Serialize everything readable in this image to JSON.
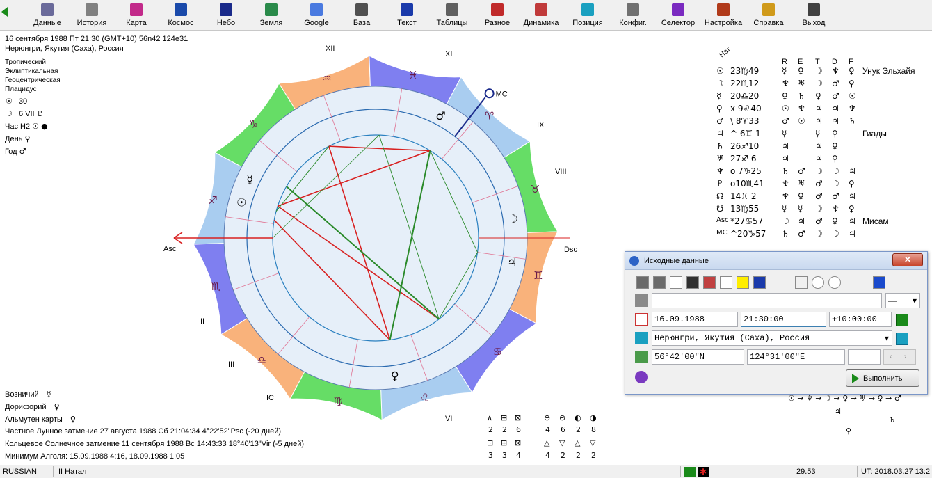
{
  "toolbar": {
    "items": [
      {
        "label": "Данные",
        "icon": "data-icon",
        "color": "#6a6a9a"
      },
      {
        "label": "История",
        "icon": "history-icon",
        "color": "#808080"
      },
      {
        "label": "Карта",
        "icon": "chart-icon",
        "color": "#c22a8a"
      },
      {
        "label": "Космос",
        "icon": "cosmos-icon",
        "color": "#1a4aaa"
      },
      {
        "label": "Небо",
        "icon": "sky-icon",
        "color": "#1a2a8a"
      },
      {
        "label": "Земля",
        "icon": "earth-icon",
        "color": "#2a8a4a"
      },
      {
        "label": "Google",
        "icon": "google-icon",
        "color": "#4a7ae0"
      },
      {
        "label": "База",
        "icon": "database-icon",
        "color": "#505050"
      },
      {
        "label": "Текст",
        "icon": "text-icon",
        "color": "#1a3aaa"
      },
      {
        "label": "Таблицы",
        "icon": "tables-icon",
        "color": "#606060"
      },
      {
        "label": "Разное",
        "icon": "misc-icon",
        "color": "#c02a2a"
      },
      {
        "label": "Динамика",
        "icon": "dynamics-icon",
        "color": "#c03a3a"
      },
      {
        "label": "Позиция",
        "icon": "position-icon",
        "color": "#1aa0c0"
      },
      {
        "label": "Конфиг.",
        "icon": "config-icon",
        "color": "#707070"
      },
      {
        "label": "Селектор",
        "icon": "selector-icon",
        "color": "#7a2ac0"
      },
      {
        "label": "Настройка",
        "icon": "settings-icon",
        "color": "#b03a1a"
      },
      {
        "label": "Справка",
        "icon": "help-icon",
        "color": "#d09a1a"
      },
      {
        "label": "Выход",
        "icon": "exit-icon",
        "color": "#404040"
      }
    ]
  },
  "header": {
    "line1": "16 сентября 1988  Пт  21:30 (GMT+10) 56n42  124e31",
    "line2": "Нерюнгри, Якутия (Саха), Россия",
    "settings": [
      "Тропический",
      "Эклиптикальная",
      "Геоцентрическая",
      "Плацидус"
    ],
    "moon_day": "30",
    "moon_phase": "6 VII",
    "hour_label": "Час H2",
    "day_label": "День",
    "year_label": "Год"
  },
  "bottom_left": {
    "lines": [
      "Возничий",
      "Дорифорий",
      "Альмутен карты",
      "Частное Лунное затмение 27 августа 1988 Сб 21:04:34  4°22'52\"Psc (-20 дней)",
      "Кольцевое Солнечное затмение 11 сентября 1988 Вс 14:43:33 18°40'13\"Vir (-5 дней)",
      "Минимум Алголя: 15.09.1988  4:16,  18.09.1988  1:05"
    ]
  },
  "wheel": {
    "houses": [
      "XII",
      "XI",
      "IX",
      "VIII",
      "II",
      "III",
      "IC",
      "VI"
    ],
    "asc": "Asc",
    "dsc": "Dsc",
    "mc": "MC",
    "sign_colors": {
      "fire": "#f9b27b",
      "earth": "#66dd66",
      "air": "#a9cdf0",
      "water": "#7f7ff0"
    },
    "planets": [
      {
        "sym": "☉",
        "angle": 15
      },
      {
        "sym": "☽",
        "angle": 172
      },
      {
        "sym": "☿",
        "angle": 25
      },
      {
        "sym": "♀",
        "angle": 262
      },
      {
        "sym": "♂",
        "angle": 118
      },
      {
        "sym": "♃",
        "angle": 190
      }
    ],
    "zodiac": [
      {
        "sym": "♓",
        "angle": 103
      },
      {
        "sym": "♈",
        "angle": 133
      },
      {
        "sym": "♉",
        "angle": 163
      },
      {
        "sym": "♊",
        "angle": 193
      },
      {
        "sym": "♋",
        "angle": 223
      },
      {
        "sym": "♌",
        "angle": 253
      },
      {
        "sym": "♍",
        "angle": 283
      },
      {
        "sym": "♎",
        "angle": 313
      },
      {
        "sym": "♏",
        "angle": 343
      },
      {
        "sym": "♐",
        "angle": 13
      },
      {
        "sym": "♑",
        "angle": 43
      },
      {
        "sym": "♒",
        "angle": 73
      }
    ]
  },
  "right_table": {
    "header_rotated": "Нат",
    "cols": [
      "R",
      "E",
      "T",
      "D",
      "F"
    ],
    "rows": [
      {
        "p": "☉",
        "deg": "23♍49",
        "c": [
          "☿",
          "♀",
          "☽",
          "♆",
          "♀"
        ],
        "note": "Унук Эльхайя"
      },
      {
        "p": "☽",
        "deg": "22♏12",
        "c": [
          "♆",
          "♅",
          "☽",
          "♂",
          "♀"
        ],
        "note": ""
      },
      {
        "p": "☿",
        "deg": "20♎20",
        "c": [
          "♀",
          "♄",
          "♀",
          "♂",
          "☉"
        ],
        "note": ""
      },
      {
        "p": "♀",
        "deg": "x 9♌40",
        "c": [
          "☉",
          "♆",
          "♃",
          "♃",
          "♆"
        ],
        "note": ""
      },
      {
        "p": "♂",
        "deg": "\\ 8♈33",
        "c": [
          "♂",
          "☉",
          "♃",
          "♃",
          "♄"
        ],
        "note": ""
      },
      {
        "p": "♃",
        "deg": "^ 6♊ 1",
        "c": [
          "☿",
          "",
          "☿",
          "♀",
          ""
        ],
        "note": "Гиады"
      },
      {
        "p": "♄",
        "deg": "26♐10",
        "c": [
          "♃",
          "",
          "♃",
          "♀",
          ""
        ],
        "note": ""
      },
      {
        "p": "♅",
        "deg": "27♐ 6",
        "c": [
          "♃",
          "",
          "♃",
          "♀",
          ""
        ],
        "note": ""
      },
      {
        "p": "♆",
        "deg": "o 7♑25",
        "c": [
          "♄",
          "♂",
          "☽",
          "☽",
          "♃"
        ],
        "note": ""
      },
      {
        "p": "♇",
        "deg": "o10♏41",
        "c": [
          "♆",
          "♅",
          "♂",
          "☽",
          "♀"
        ],
        "note": ""
      },
      {
        "p": "☊",
        "deg": "14♓ 2",
        "c": [
          "♆",
          "♀",
          "♂",
          "♂",
          "♃"
        ],
        "note": ""
      },
      {
        "p": "☋",
        "deg": "13♍55",
        "c": [
          "☿",
          "☿",
          "☽",
          "♆",
          "♀"
        ],
        "note": ""
      },
      {
        "p": "Asc",
        "deg": "*27♋57",
        "c": [
          "☽",
          "♃",
          "♂",
          "♀",
          "♃"
        ],
        "note": "Мисам"
      },
      {
        "p": "MC",
        "deg": "^20♑57",
        "c": [
          "♄",
          "♂",
          "☽",
          "☽",
          "♃"
        ],
        "note": ""
      }
    ]
  },
  "dialog": {
    "title": "Исходные данные",
    "name_value": "",
    "name_dropdown": "—",
    "date_value": "16.09.1988",
    "time_value": "21:30:00",
    "tz_value": "+10:00:00",
    "place_value": "Нерюнгри, Якутия (Саха), Россия",
    "lat_value": "56°42'00\"N",
    "lon_value": "124°31'00\"E",
    "alt_value": "",
    "execute_label": "Выполнить",
    "close_label": "✕"
  },
  "aspects_summary": {
    "row1_labels": [
      "2",
      "2",
      "6"
    ],
    "row1b_labels": [
      "4",
      "6",
      "2",
      "8"
    ],
    "row2_labels": [
      "3",
      "3",
      "4"
    ],
    "row2b_labels": [
      "4",
      "2",
      "2",
      "2"
    ]
  },
  "right_chain": "☉ → ♆ → ☽ → ♀ → ♅ → ♀ → ♂",
  "status": {
    "lang": "RUSSIAN",
    "mode": "II Натал",
    "value": "29.53",
    "ut": "UT: 2018.03.27 13:2"
  }
}
